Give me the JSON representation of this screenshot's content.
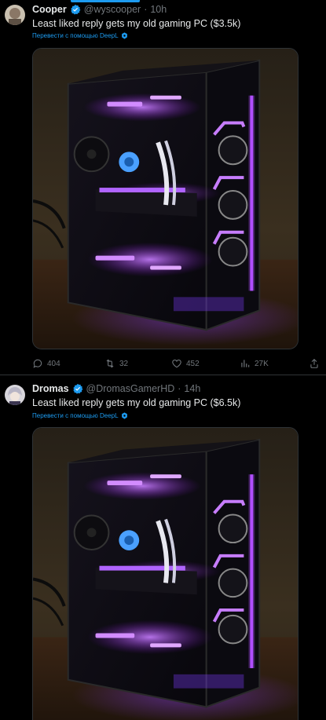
{
  "tweets": [
    {
      "name": "Cooper",
      "handle": "@wyscooper",
      "separator": "·",
      "time": "10h",
      "text": "Least liked reply gets my old gaming PC ($3.5k)",
      "translate": "Перевести с помощью DeepL",
      "stats": {
        "replies": "404",
        "retweets": "32",
        "likes": "452",
        "views": "27K"
      }
    },
    {
      "name": "Dromas",
      "handle": "@DromasGamerHD",
      "separator": "·",
      "time": "14h",
      "text": "Least liked reply gets my old gaming PC ($6.5k)",
      "translate": "Перевести с помощью DeepL"
    }
  ],
  "icons": {
    "verified": "verified-badge-icon",
    "reply": "reply-icon",
    "retweet": "retweet-icon",
    "like": "heart-icon",
    "views": "views-icon",
    "share": "share-icon",
    "deepl": "deepl-icon"
  },
  "colors": {
    "background": "#000000",
    "accent": "#1d9bf0",
    "muted": "#71767b",
    "text": "#e7e9ea",
    "rgb_glow": "#a040ff"
  }
}
